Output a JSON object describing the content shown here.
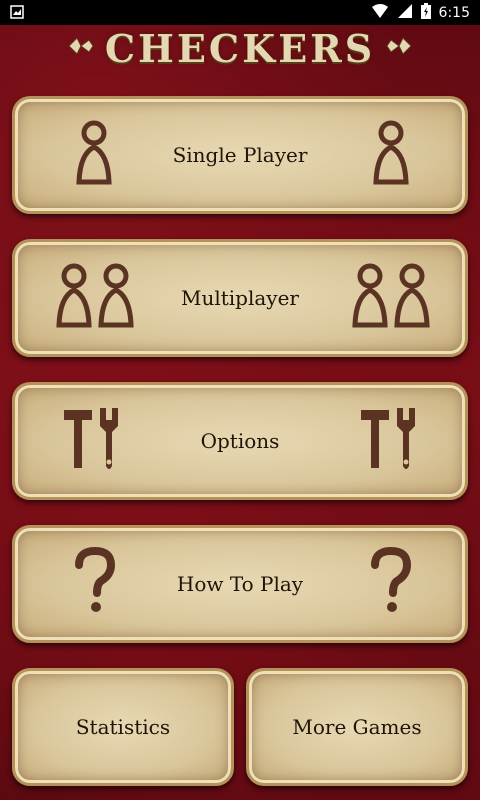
{
  "status_bar": {
    "time": "6:15",
    "icons": [
      "notification-icon",
      "wifi-icon",
      "cell-signal-icon",
      "battery-icon"
    ]
  },
  "title": "CHECKERS",
  "buttons": {
    "single_player": {
      "label": "Single Player",
      "icon": "person-icon"
    },
    "multiplayer": {
      "label": "Multiplayer",
      "icon": "people-icon"
    },
    "options": {
      "label": "Options",
      "icon": "tools-icon"
    },
    "how_to_play": {
      "label": "How To Play",
      "icon": "question-icon"
    },
    "statistics": {
      "label": "Statistics"
    },
    "more_games": {
      "label": "More Games"
    }
  },
  "colors": {
    "background": "#6e0c16",
    "panel": "#dcc89d",
    "panel_border": "#b4925a",
    "icon": "#5a3322",
    "text": "#1e1408"
  }
}
